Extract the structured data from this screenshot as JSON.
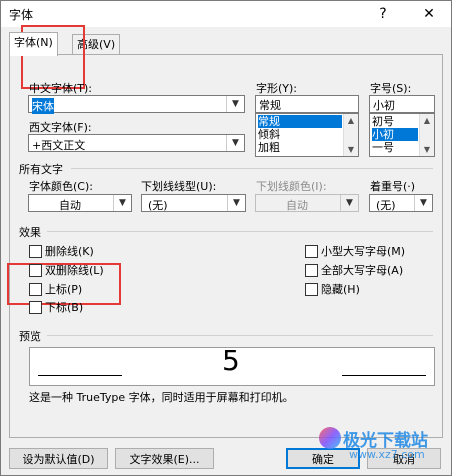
{
  "window": {
    "title": "字体",
    "help": "?",
    "close": "✕"
  },
  "tabs": [
    {
      "label": "字体(N)"
    },
    {
      "label": "高级(V)"
    }
  ],
  "font": {
    "chinese_label": "中文字体(T):",
    "chinese_value": "宋体",
    "western_label": "西文字体(F):",
    "western_value": "+西文正文",
    "style_label": "字形(Y):",
    "style_value": "常规",
    "style_list": [
      "常规",
      "倾斜",
      "加粗"
    ],
    "size_label": "字号(S):",
    "size_value": "小初",
    "size_list": [
      "初号",
      "小初",
      "一号"
    ]
  },
  "all_text": {
    "section": "所有文字",
    "color_label": "字体颜色(C):",
    "color_value": "自动",
    "underline_label": "下划线线型(U):",
    "underline_value": "(无)",
    "underline_color_label": "下划线颜色(I):",
    "underline_color_value": "自动",
    "emphasis_label": "着重号(·)",
    "emphasis_value": "(无)"
  },
  "effects": {
    "section": "效果",
    "left": [
      "删除线(K)",
      "双删除线(L)",
      "上标(P)",
      "下标(B)"
    ],
    "right": [
      "小型大写字母(M)",
      "全部大写字母(A)",
      "隐藏(H)"
    ]
  },
  "preview": {
    "section": "预览",
    "glyph": "5",
    "note": "这是一种 TrueType 字体，同时适用于屏幕和打印机。"
  },
  "buttons": {
    "default": "设为默认值(D)",
    "effects": "文字效果(E)...",
    "ok": "确定",
    "cancel": "取消"
  },
  "watermark": {
    "brand": "极光下载站",
    "url": "www.xz7.com"
  }
}
